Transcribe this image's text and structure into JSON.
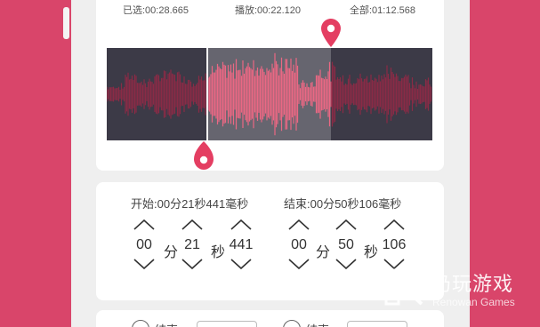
{
  "colors": {
    "accent": "#e43e62",
    "wave_bg": "#3c3a47",
    "page_bg": "#d9456a"
  },
  "times": {
    "selected": "已选:00:28.665",
    "played": "播放:00:22.120",
    "total": "全部:01:12.568"
  },
  "start": {
    "label": "开始:00分21秒441毫秒",
    "min": "00",
    "min_unit": "分",
    "sec": "21",
    "sec_unit": "秒",
    "ms": "441"
  },
  "end": {
    "label": "结束:00分50秒106毫秒",
    "min": "00",
    "min_unit": "分",
    "sec": "50",
    "sec_unit": "秒",
    "ms": "106"
  },
  "bottom": {
    "label1": "结束",
    "label2": "结束"
  },
  "watermark": {
    "title": "仍玩游戏",
    "subtitle": "Renowan Games"
  },
  "icons": {
    "up": "chevron-up-icon",
    "down": "chevron-down-icon",
    "pin": "location-pin-icon"
  }
}
